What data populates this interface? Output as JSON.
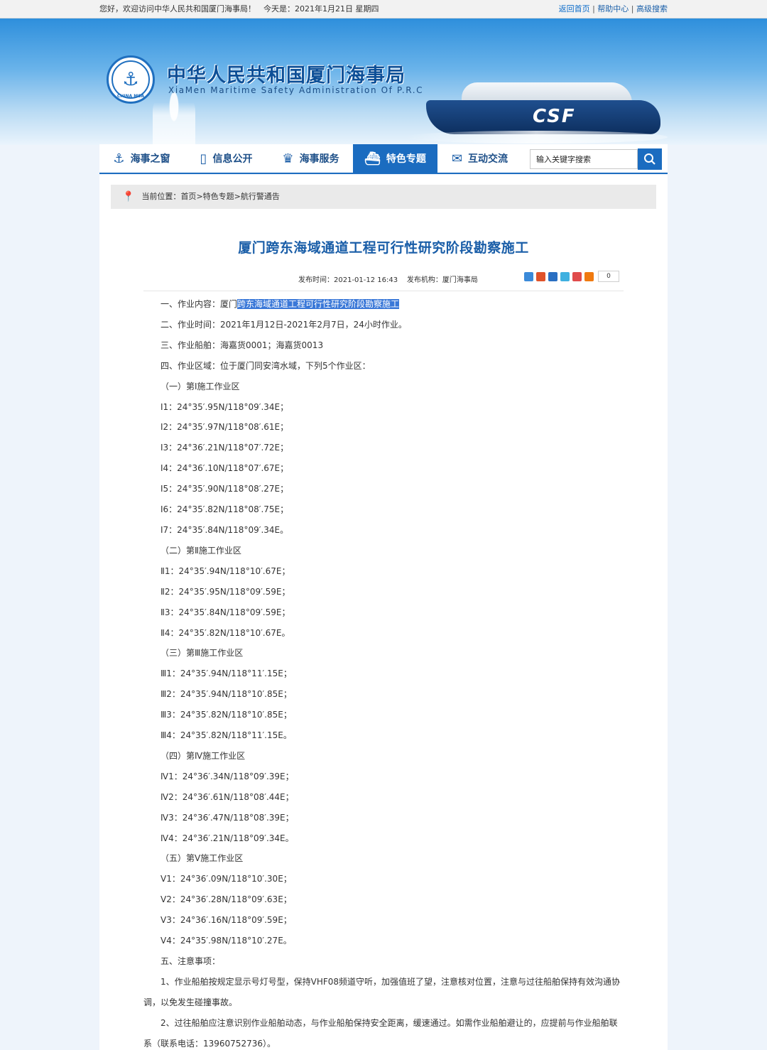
{
  "topbar": {
    "greeting": "您好，欢迎访问中华人民共和国厦门海事局！　今天是：2021年1月21日 星期四",
    "links": [
      "返回首页",
      "帮助中心",
      "高级搜索"
    ]
  },
  "header": {
    "site_name_cn": "中华人民共和国厦门海事局",
    "site_name_en": "XiaMen Maritime Safety Administration Of P.R.C",
    "logo_text": "CHINA MSA",
    "ship_text": "CSF"
  },
  "nav": {
    "items": [
      "海事之窗",
      "信息公开",
      "海事服务",
      "特色专题",
      "互动交流"
    ],
    "active_index": 3,
    "search_placeholder": "输入关键字搜索"
  },
  "breadcrumb": {
    "label": "当前位置：",
    "items": [
      "首页",
      "特色专题",
      "航行警通告"
    ],
    "sep": " >"
  },
  "article": {
    "title": "厦门跨东海域通道工程可行性研究阶段勘察施工",
    "publish_time": "发布时间：2021-01-12 16:43",
    "publisher": "发布机构：厦门海事局",
    "share_count": "0",
    "first_line_prefix": "一、作业内容：厦门",
    "first_line_selected": "跨东海域通道工程可行性研究阶段勘察施工",
    "lines": [
      "二、作业时间：2021年1月12日-2021年2月7日，24小时作业。",
      "三、作业船舶：海嘉货0001；海嘉货0013",
      "四、作业区域：位于厦门同安湾水域，下列5个作业区：",
      "（一）第Ⅰ施工作业区",
      "Ⅰ1：24°35′.95N/118°09′.34E；",
      "Ⅰ2：24°35′.97N/118°08′.61E；",
      "Ⅰ3：24°36′.21N/118°07′.72E；",
      "Ⅰ4：24°36′.10N/118°07′.67E；",
      "Ⅰ5：24°35′.90N/118°08′.27E；",
      "Ⅰ6：24°35′.82N/118°08′.75E；",
      "Ⅰ7：24°35′.84N/118°09′.34E。",
      "（二）第Ⅱ施工作业区",
      "Ⅱ1：24°35′.94N/118°10′.67E；",
      "Ⅱ2：24°35′.95N/118°09′.59E；",
      "Ⅱ3：24°35′.84N/118°09′.59E；",
      "Ⅱ4：24°35′.82N/118°10′.67E。",
      "（三）第Ⅲ施工作业区",
      "Ⅲ1：24°35′.94N/118°11′.15E；",
      "Ⅲ2：24°35′.94N/118°10′.85E；",
      "Ⅲ3：24°35′.82N/118°10′.85E；",
      "Ⅲ4：24°35′.82N/118°11′.15E。",
      "（四）第Ⅳ施工作业区",
      "Ⅳ1：24°36′.34N/118°09′.39E；",
      "Ⅳ2：24°36′.61N/118°08′.44E；",
      "Ⅳ3：24°36′.47N/118°08′.39E；",
      "Ⅳ4：24°36′.21N/118°09′.34E。",
      "（五）第Ⅴ施工作业区",
      "Ⅴ1：24°36′.09N/118°10′.30E；",
      "Ⅴ2：24°36′.28N/118°09′.63E；",
      "Ⅴ3：24°36′.16N/118°09′.59E；",
      "Ⅴ4：24°35′.98N/118°10′.27E。",
      "五、注意事项："
    ],
    "notes": [
      "1、作业船舶按规定显示号灯号型，保持VHF08频道守听，加强值班了望，注意核对位置，注意与过往船舶保持有效沟通协调，以免发生碰撞事故。",
      "2、过往船舶应注意识别作业船舶动态，与作业船舶保持安全距离，缓速通过。如需作业船舶避让的，应提前与作业船舶联系（联系电话：13960752736）。"
    ]
  },
  "colors": {
    "accent": "#1b6cc0",
    "title": "#1a5ea8",
    "selection": "#3a78d8"
  }
}
